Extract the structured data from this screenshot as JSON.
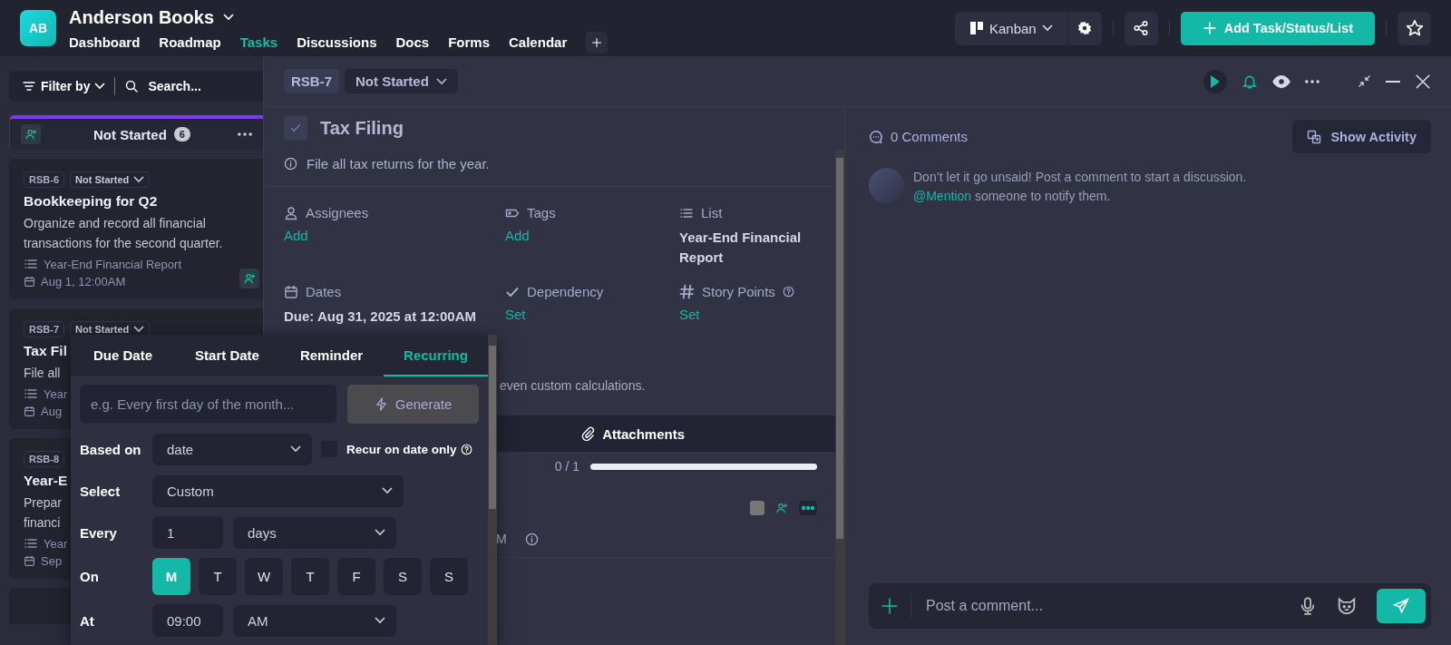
{
  "app": {
    "initials": "AB",
    "workspace": "Anderson Books"
  },
  "nav": [
    {
      "label": "Dashboard",
      "selected": false
    },
    {
      "label": "Roadmap",
      "selected": false
    },
    {
      "label": "Tasks",
      "selected": true
    },
    {
      "label": "Discussions",
      "selected": false
    },
    {
      "label": "Docs",
      "selected": false
    },
    {
      "label": "Forms",
      "selected": false
    },
    {
      "label": "Calendar",
      "selected": false
    }
  ],
  "toolbar": {
    "view": "Kanban",
    "primary_action": "Add Task/Status/List"
  },
  "board": {
    "filter": "Filter by",
    "search_placeholder": "Search...",
    "column": {
      "title": "Not Started",
      "count": "6"
    },
    "cards": [
      {
        "id": "RSB-6",
        "status": "Not Started",
        "title": "Bookkeeping for Q2",
        "description": [
          "Organize and record all financial",
          "transactions for the second quarter."
        ],
        "list": "Year-End Financial Report",
        "date": "Aug 1, 12:00AM"
      },
      {
        "id": "RSB-7",
        "status": "Not Started",
        "title": "Tax Fil",
        "description": [
          "File all"
        ],
        "list": "Year",
        "date": "Aug"
      },
      {
        "id": "RSB-8",
        "title": "Year-E",
        "description": [
          "Prepar",
          "financi"
        ],
        "list": "Year",
        "date": "Sep"
      }
    ]
  },
  "task": {
    "id": "RSB-7",
    "status": "Not Started",
    "done": false,
    "title": "Tax Filing",
    "description": "File all tax returns for the year.",
    "fields": [
      {
        "kind": "assignees",
        "label": "Assignees",
        "value": "Add"
      },
      {
        "kind": "tags",
        "label": "Tags",
        "value": "Add"
      },
      {
        "kind": "list",
        "label": "List",
        "value": "Year-End Financial Report"
      },
      {
        "kind": "dates",
        "label": "Dates",
        "value": "Due: Aug 31, 2025 at 12:00AM"
      },
      {
        "kind": "dependency",
        "label": "Dependency",
        "value": "Set"
      },
      {
        "kind": "points",
        "label": "Story Points",
        "value": "Set",
        "help": true
      }
    ],
    "note": "even custom calculations.",
    "tabs": [
      {
        "label": "Attachments",
        "selected": true
      }
    ],
    "progress": {
      "reading": "0 / 1",
      "level": 0
    },
    "time_fragment": "M"
  },
  "comments": {
    "count_label": "0 Comments",
    "activity_button": "Show Activity",
    "empty_text": "Don’t let it go unsaid! Post a comment to start a discussion.",
    "mention": "@Mention",
    "mention_rest": "someone to notify them.",
    "composer_placeholder": "Post a comment..."
  },
  "popup": {
    "tabs": [
      {
        "label": "Due Date",
        "selected": false
      },
      {
        "label": "Start Date",
        "selected": false
      },
      {
        "label": "Reminder",
        "selected": false
      },
      {
        "label": "Recurring",
        "selected": true
      }
    ],
    "prompt_placeholder": "e.g. Every first day of the month...",
    "generate": "Generate",
    "generate_disabled": true,
    "based_on": {
      "label": "Based on",
      "value": "date",
      "checkbox_label": "Recur on date only",
      "checked": false
    },
    "select": {
      "label": "Select",
      "value": "Custom"
    },
    "every": {
      "label": "Every",
      "count": "1",
      "unit": "days"
    },
    "on": {
      "label": "On",
      "days": [
        {
          "label": "M",
          "selected": true
        },
        {
          "label": "T",
          "selected": false
        },
        {
          "label": "W",
          "selected": false
        },
        {
          "label": "T",
          "selected": false
        },
        {
          "label": "F",
          "selected": false
        },
        {
          "label": "S",
          "selected": false
        },
        {
          "label": "S",
          "selected": false
        }
      ]
    },
    "at": {
      "label": "At",
      "time": "09:00",
      "period": "AM"
    }
  }
}
